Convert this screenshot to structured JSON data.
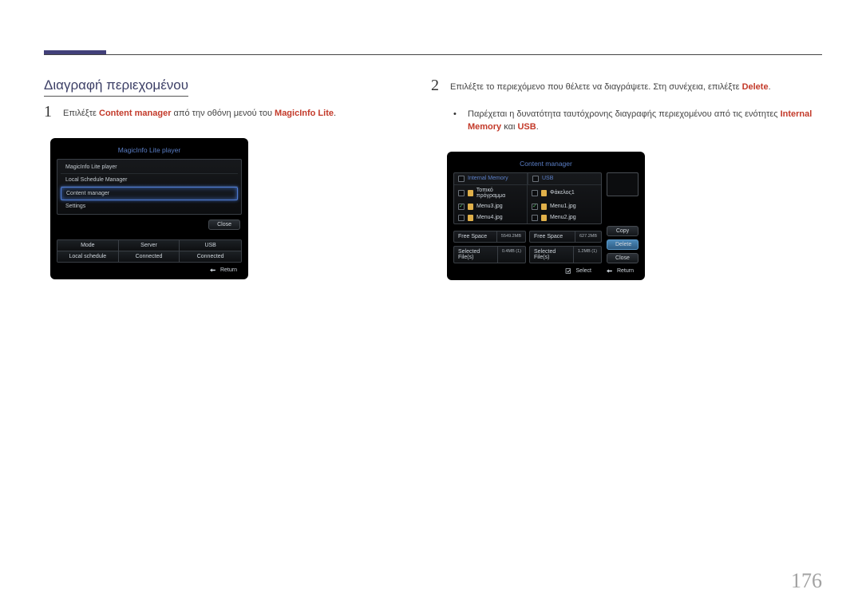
{
  "page_number": "176",
  "section_title": "Διαγραφή περιεχομένου",
  "step1": {
    "num": "1",
    "pre": "Επιλέξτε ",
    "red1": "Content manager",
    "mid": " από την οθόνη μενού του ",
    "red2": "MagicInfo Lite",
    "post": "."
  },
  "step2": {
    "num": "2",
    "pre": "Επιλέξτε το περιεχόμενο που θέλετε να διαγράψετε. Στη συνέχεια, επιλέξτε ",
    "red": "Delete",
    "post": "."
  },
  "bullet": {
    "mark": "•",
    "pre": "Παρέχεται η δυνατότητα ταυτόχρονης διαγραφής περιεχομένου από τις ενότητες ",
    "red1": "Internal Memory",
    "mid": " και ",
    "red2": "USB",
    "post": "."
  },
  "ui1": {
    "title": "MagicInfo Lite player",
    "items": {
      "a": "MagicInfo Lite player",
      "b": "Local Schedule Manager",
      "c": "Content manager",
      "d": "Settings"
    },
    "close": "Close",
    "grid": {
      "h1": "Mode",
      "h2": "Server",
      "h3": "USB",
      "v1": "Local schedule",
      "v2": "Connected",
      "v3": "Connected"
    },
    "return": "Return"
  },
  "ui2": {
    "title": "Content manager",
    "col1_head": "Internal Memory",
    "col2_head": "USB",
    "col1": {
      "r1": "Τοπικό πρόγραμμα",
      "r2": "Menu3.jpg",
      "r3": "Menu4.jpg"
    },
    "col2": {
      "r1": "Φάκελος1",
      "r2": "Menu1.jpg",
      "r3": "Menu2.jpg"
    },
    "btn_copy": "Copy",
    "btn_delete": "Delete",
    "btn_close": "Close",
    "sum": {
      "free": "Free Space",
      "free_v1": "5549.2MB",
      "free_v2": "627.2MB",
      "sel": "Selected File(s)",
      "sel_v1": "0.4MB (1)",
      "sel_v2": "1.2MB (1)"
    },
    "select": "Select",
    "return": "Return"
  }
}
